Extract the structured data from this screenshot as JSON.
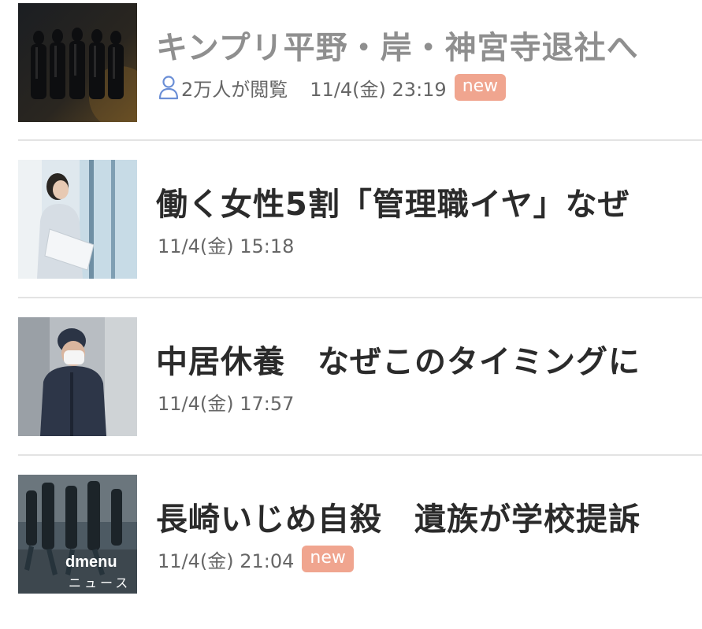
{
  "articles": [
    {
      "title": "キンプリ平野・岸・神宮寺退社へ",
      "views": "2万人が閲覧",
      "timestamp": "11/4(金) 23:19",
      "badge": "new",
      "thumbnail": "group-photo"
    },
    {
      "title": "働く女性5割「管理職イヤ」なぜ",
      "timestamp": "11/4(金) 15:18",
      "thumbnail": "woman-by-window-photo"
    },
    {
      "title": "中居休養　なぜこのタイミングに",
      "timestamp": "11/4(金) 17:57",
      "thumbnail": "masked-man-photo"
    },
    {
      "title": "長崎いじめ自殺　遺族が学校提訴",
      "timestamp": "11/4(金) 21:04",
      "badge": "new",
      "thumbnail": "dmenu-news-photo",
      "thumbnail_brand": "dmenu",
      "thumbnail_brand_sub": "ニュース"
    }
  ],
  "colors": {
    "badge_bg": "#f0a58f",
    "views_icon": "#6b8fd6",
    "title_read": "#8f8f8f",
    "title_unread": "#2b2b2b"
  },
  "icons": {
    "views": "person-icon"
  }
}
